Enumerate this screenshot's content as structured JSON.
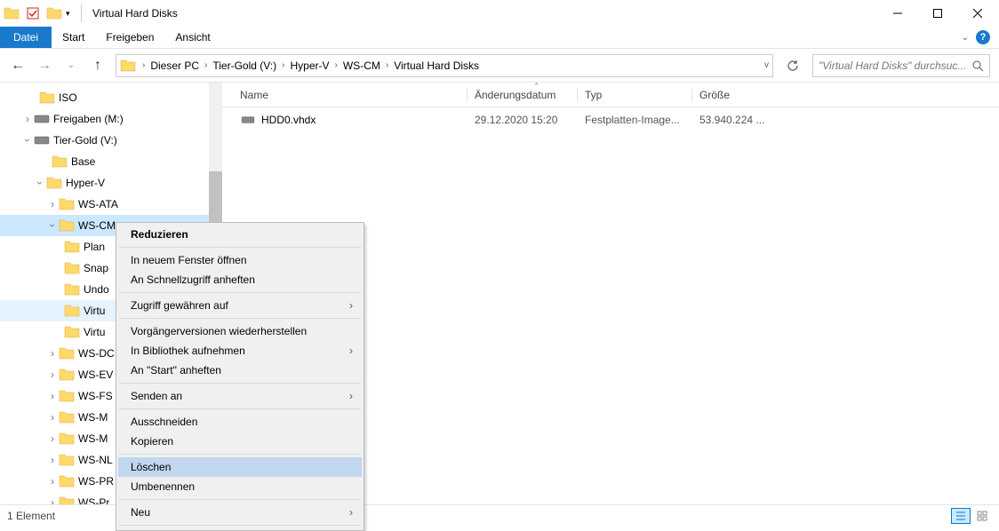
{
  "titlebar": {
    "title": "Virtual Hard Disks"
  },
  "menubar": {
    "datei": "Datei",
    "start": "Start",
    "freigeben": "Freigeben",
    "ansicht": "Ansicht"
  },
  "breadcrumb": {
    "items": [
      "Dieser PC",
      "Tier-Gold (V:)",
      "Hyper-V",
      "WS-CM",
      "Virtual Hard Disks"
    ],
    "dropdown": "v"
  },
  "search": {
    "placeholder": "\"Virtual Hard Disks\" durchsuc..."
  },
  "columns": {
    "name": "Name",
    "date": "Änderungsdatum",
    "type": "Typ",
    "size": "Größe"
  },
  "files": [
    {
      "name": "HDD0.vhdx",
      "date": "29.12.2020 15:20",
      "type": "Festplatten-Image...",
      "size": "53.940.224 ..."
    }
  ],
  "tree": {
    "iso": "ISO",
    "freigaben": "Freigaben (M:)",
    "tiergold": "Tier-Gold (V:)",
    "base": "Base",
    "hyperv": "Hyper-V",
    "wsata": "WS-ATA",
    "wscm": "WS-CM",
    "plan": "Plan",
    "snap": "Snap",
    "undo": "Undo",
    "virt": "Virtu",
    "virt2": "Virtu",
    "wsdc": "WS-DC",
    "wsev": "WS-EV",
    "wsfs": "WS-FS",
    "wsm": "WS-M",
    "wsm2": "WS-M",
    "wsnl": "WS-NL",
    "wspr": "WS-PR",
    "wspr2": "WS-Pr"
  },
  "contextmenu": {
    "reduzieren": "Reduzieren",
    "neufenster": "In neuem Fenster öffnen",
    "schnellzugriff": "An Schnellzugriff anheften",
    "zugriff": "Zugriff gewähren auf",
    "vorgaenger": "Vorgängerversionen wiederherstellen",
    "bibliothek": "In Bibliothek aufnehmen",
    "startanheften": "An \"Start\" anheften",
    "sendenan": "Senden an",
    "ausschneiden": "Ausschneiden",
    "kopieren": "Kopieren",
    "loeschen": "Löschen",
    "umbenennen": "Umbenennen",
    "neu": "Neu"
  },
  "statusbar": {
    "count": "1 Element"
  }
}
